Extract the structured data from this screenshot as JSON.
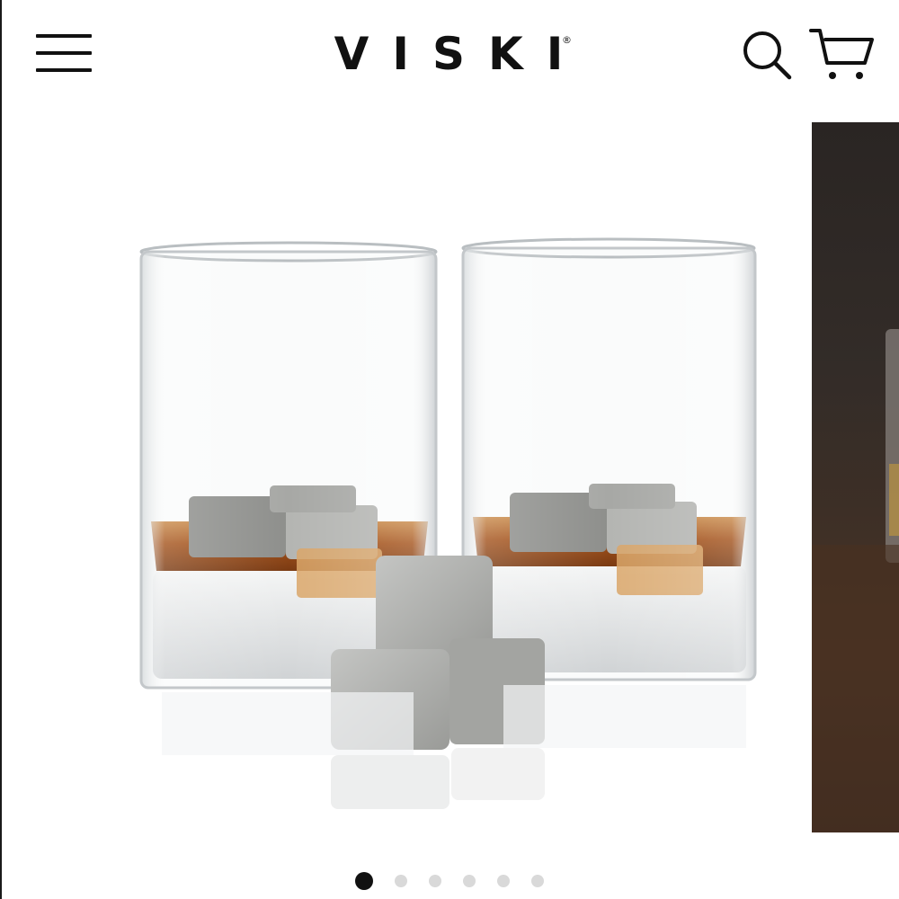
{
  "header": {
    "menu_icon": "hamburger-menu-icon",
    "logo_text": "VISKI",
    "logo_mark": "®",
    "search_icon": "search-icon",
    "cart_icon": "cart-icon"
  },
  "carousel": {
    "slide_count": 6,
    "active_index": 0,
    "main_slide_subject": "two-whiskey-glasses-with-stones",
    "next_slide_subject": "whiskey-glass-on-wood"
  },
  "colors": {
    "brand_text": "#111111",
    "dot_active": "#111111",
    "dot_inactive": "#d9d9d9",
    "whiskey": "#a0521a",
    "stone": "#a9aaa7"
  }
}
